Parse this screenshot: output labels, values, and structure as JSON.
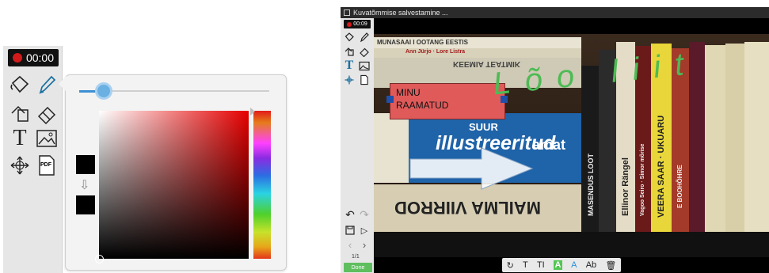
{
  "left_panel": {
    "timer": "00:00",
    "tools": [
      "fill-bucket-icon",
      "pen-icon",
      "shape-icon",
      "eraser-icon",
      "text-icon",
      "image-icon",
      "move-icon",
      "pdf-icon"
    ],
    "pdf_label": "PDF",
    "text_tool_label": "T",
    "picker": {
      "selected_color": "#000000",
      "hue": "#e60000"
    }
  },
  "right_panel": {
    "window_title": "Kuvatõmmise salvestamine ...",
    "timer": "00:09",
    "pager": "1/1",
    "done_label": "Done",
    "annotation": {
      "text": "MINU\nRAAMATUD",
      "box_color": "#e05a5a"
    },
    "handwriting": "Lõo liit",
    "books": {
      "book1": "MUNASAAI I OOTANG EESTIS",
      "book2": "Ann Jürjo · Lore Listra",
      "book3": "KEEMIA TEATMIK",
      "book4_title": "SUUR",
      "book4_main": "illustreeritud",
      "book4_end": "amat",
      "book5": "MAILMA VIIRROD",
      "spine1": "MASENDUS LOOT",
      "spine2": "Ellinor Rängel",
      "spine3": "Vagoo Seiro · Simor mõrise",
      "spine4": "VEERA SAAR · UKUARU",
      "spine5": "E BOOHÕHRE"
    },
    "text_toolbar": [
      "rotate",
      "T",
      "TI",
      "A",
      "A",
      "Ab",
      "trash"
    ]
  }
}
